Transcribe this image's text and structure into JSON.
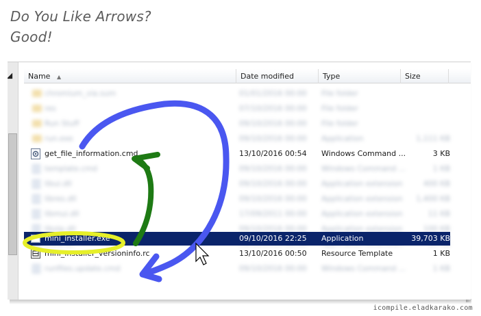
{
  "title": {
    "line1": "Do You Like Arrows?",
    "line2": "Good!"
  },
  "explorer": {
    "columns": {
      "name": "Name",
      "date": "Date modified",
      "type": "Type",
      "size": "Size"
    },
    "sort_glyph": "▲",
    "files": [
      {
        "name": "get_file_information.cmd",
        "date": "13/10/2016 00:54",
        "type": "Windows Command ...",
        "size": "3 KB",
        "icon": "cmd-file-icon"
      },
      {
        "name": "mini_installer.exe",
        "date": "09/10/2016 22:25",
        "type": "Application",
        "size": "39,703 KB",
        "icon": "exe-file-icon",
        "selected": true
      },
      {
        "name": "mini_installer_versioninfo.rc",
        "date": "13/10/2016 00:50",
        "type": "Resource Template",
        "size": "1 KB",
        "icon": "rc-file-icon"
      }
    ],
    "blurred_rows": [
      {
        "name": "chromium_via.sum",
        "date": "01/01/2016 00:00",
        "type": "File folder",
        "size": ""
      },
      {
        "name": "res",
        "date": "07/10/2016 00:00",
        "type": "File folder",
        "size": ""
      },
      {
        "name": "Run Stuff",
        "date": "09/10/2016 00:00",
        "type": "File folder",
        "size": ""
      },
      {
        "name": "run.exe",
        "date": "09/10/2016 00:00",
        "type": "Application",
        "size": "1,111 KB"
      },
      {
        "name": "template.cmd",
        "date": "09/10/2016 00:00",
        "type": "Windows Command ...",
        "size": "1 KB"
      },
      {
        "name": "libui.dll",
        "date": "09/10/2016 00:00",
        "type": "Application extension",
        "size": "400 KB"
      },
      {
        "name": "libres.dll",
        "date": "09/10/2016 00:00",
        "type": "Application extension",
        "size": "1,400 KB"
      },
      {
        "name": "libmui.dll",
        "date": "17/09/2011 00:00",
        "type": "Application extension",
        "size": "11 KB"
      },
      {
        "name": "libzip.dll",
        "date": "09/10/2016 00:00",
        "type": "Application extension",
        "size": "100 KB"
      },
      {
        "name": "zlibw.dll",
        "date": "09/10/2016 00:00",
        "type": "Application extension",
        "size": "10 KB"
      },
      {
        "name": "runfiles.update.cmd",
        "date": "09/10/2016 00:00",
        "type": "Windows Command ...",
        "size": "1 KB"
      }
    ]
  },
  "annotations": {
    "blue_arrow_color": "#4a57f0",
    "green_arrow_color": "#1e7a14",
    "highlight_color": "#e6ef2a"
  },
  "watermark": "icompile.eladkarako.com"
}
